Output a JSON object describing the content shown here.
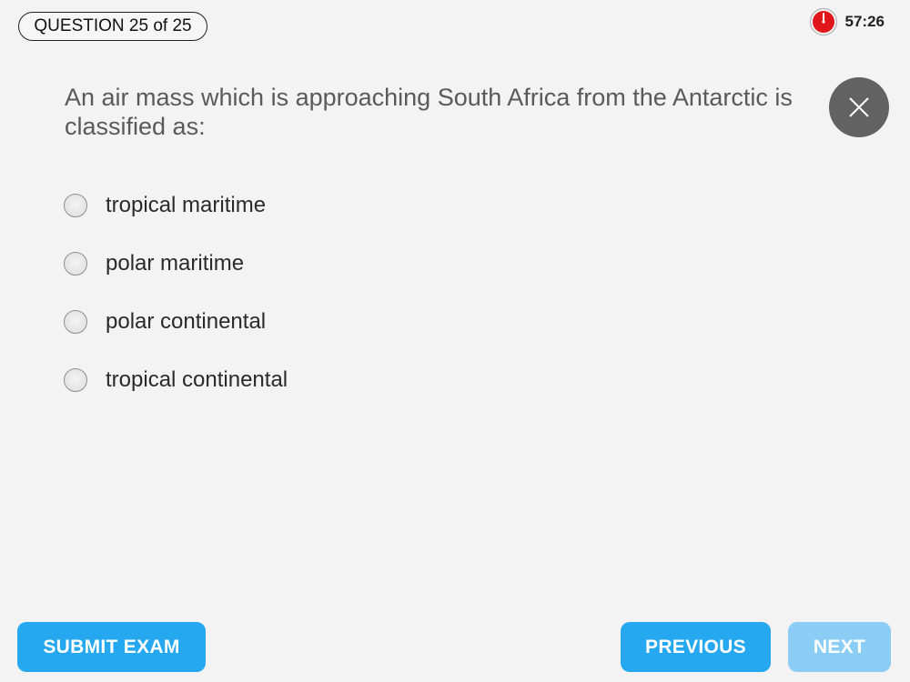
{
  "header": {
    "question_counter": "QUESTION 25 of 25",
    "timer_text": "57:26",
    "timer_icon": "stopwatch-icon",
    "timer_color": "#e0161b"
  },
  "question": {
    "text": "An air mass which is approaching South Africa from the Antarctic is classified as:"
  },
  "options": [
    {
      "label": "tropical maritime",
      "selected": false
    },
    {
      "label": "polar maritime",
      "selected": false
    },
    {
      "label": "polar continental",
      "selected": false
    },
    {
      "label": "tropical continental",
      "selected": false
    }
  ],
  "close_button": {
    "icon": "close-icon"
  },
  "footer": {
    "submit_label": "SUBMIT EXAM",
    "previous_label": "PREVIOUS",
    "next_label": "NEXT",
    "next_disabled": true,
    "accent_color": "#25a8f0",
    "disabled_color": "#8ccdf6"
  }
}
